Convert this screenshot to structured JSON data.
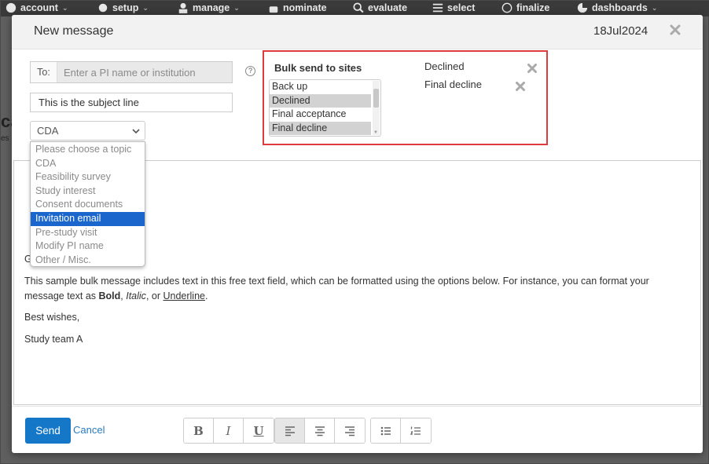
{
  "nav": {
    "items": [
      {
        "label": "account",
        "icon": "globe-icon"
      },
      {
        "label": "setup",
        "icon": "gear-icon"
      },
      {
        "label": "manage",
        "icon": "user-icon"
      },
      {
        "label": "nominate",
        "icon": "thumbs-up-icon"
      },
      {
        "label": "evaluate",
        "icon": "search-icon"
      },
      {
        "label": "select",
        "icon": "list-icon"
      },
      {
        "label": "finalize",
        "icon": "check-circle-icon"
      },
      {
        "label": "dashboards",
        "icon": "pie-chart-icon"
      }
    ]
  },
  "background": {
    "fragment_a": "ca",
    "fragment_b": "es"
  },
  "modal": {
    "title": "New message",
    "date": "18Jul2024",
    "to_label": "To:",
    "to_placeholder": "Enter a PI name or institution",
    "subject_value": "This is the subject line",
    "topic_selected": "CDA",
    "topic_options": [
      "Please choose a topic",
      "CDA",
      "Feasibility survey",
      "Study interest",
      "Consent documents",
      "Invitation email",
      "Pre-study visit",
      "Modify PI name",
      "Other / Misc."
    ],
    "topic_highlighted": "Invitation email",
    "help": "?"
  },
  "bulk": {
    "title": "Bulk send to sites",
    "options": [
      "Back up",
      "Declined",
      "Final acceptance",
      "Final decline"
    ],
    "highlighted": [
      "Declined",
      "Final decline"
    ],
    "selected": [
      "Declined",
      "Final decline"
    ]
  },
  "editor": {
    "greeting": "G",
    "body_pre": "This sample bulk message includes text in this free text field, which can be formatted using the options below. For instance, you can format your message text as ",
    "bold": "Bold",
    "sep1": ", ",
    "italic": "Italic",
    "sep2": ", or ",
    "underline": "Underline",
    "end": ".",
    "wishes": "Best wishes,",
    "signature": "Study team A"
  },
  "footer": {
    "send": "Send",
    "cancel": "Cancel",
    "bold": "B",
    "italic": "I",
    "underline": "U"
  },
  "colors": {
    "accent": "#1577c8",
    "highlight": "#e03b3b",
    "option_selected": "#1a66cc"
  }
}
